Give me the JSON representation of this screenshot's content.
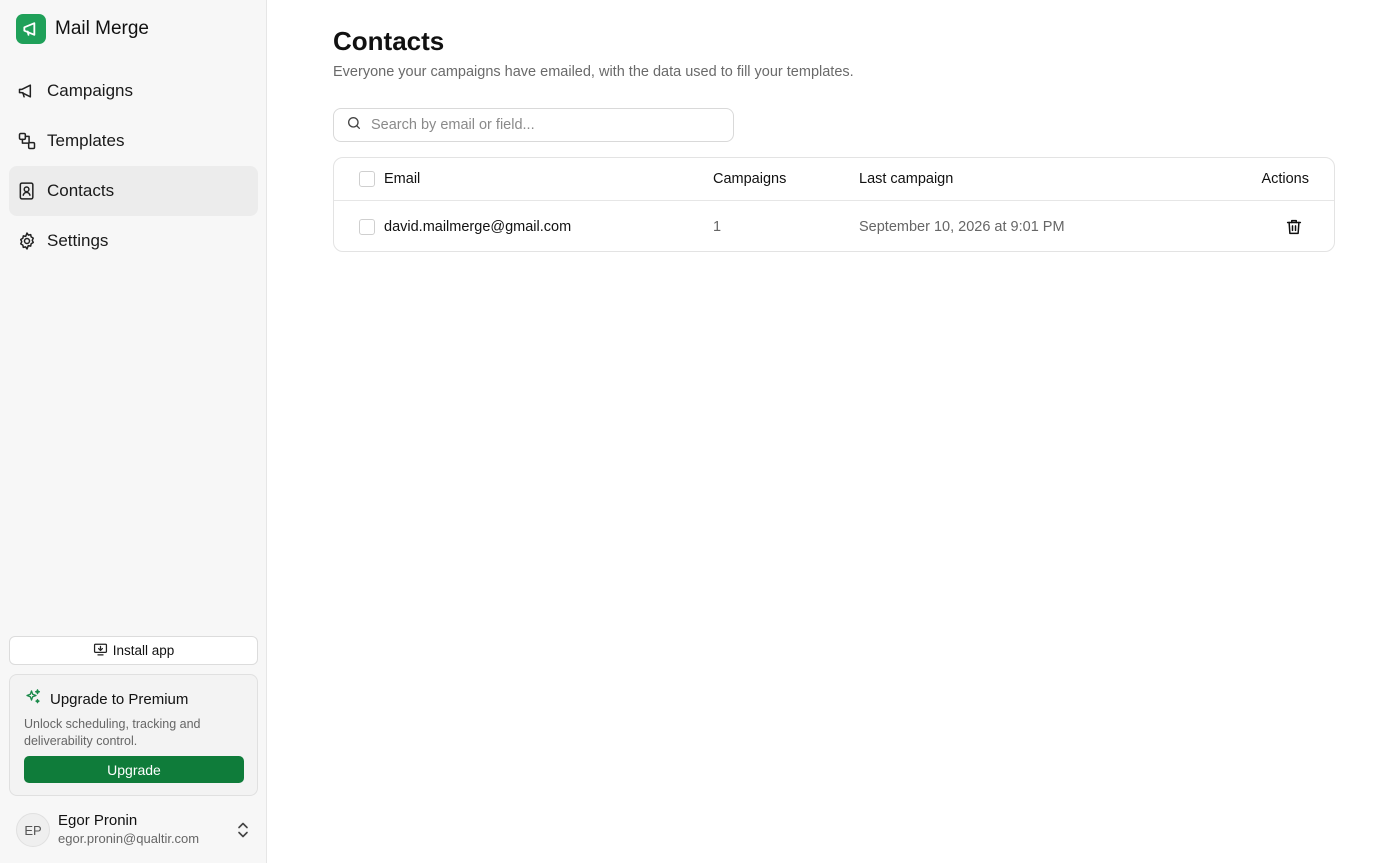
{
  "brand": {
    "name": "Mail Merge",
    "logo_icon": "megaphone-icon",
    "accent": "#1fa059"
  },
  "nav": [
    {
      "label": "Campaigns",
      "icon": "megaphone-icon",
      "active": false
    },
    {
      "label": "Templates",
      "icon": "templates-icon",
      "active": false
    },
    {
      "label": "Contacts",
      "icon": "contact-book-icon",
      "active": true
    },
    {
      "label": "Settings",
      "icon": "gear-icon",
      "active": false
    }
  ],
  "install": {
    "label": "Install app",
    "icon": "monitor-download-icon"
  },
  "premium": {
    "title": "Upgrade to Premium",
    "icon": "sparkles-icon",
    "description": "Unlock scheduling, tracking and deliverability control.",
    "button_label": "Upgrade",
    "button_color": "#0f7c3a"
  },
  "user": {
    "initials": "EP",
    "name": "Egor Pronin",
    "email": "egor.pronin@qualtir.com"
  },
  "page": {
    "title": "Contacts",
    "subtitle": "Everyone your campaigns have emailed, with the data used to fill your templates."
  },
  "search": {
    "placeholder": "Search by email or field...",
    "value": ""
  },
  "table": {
    "columns": {
      "email": "Email",
      "campaigns": "Campaigns",
      "last_campaign": "Last campaign",
      "actions": "Actions"
    },
    "rows": [
      {
        "email": "david.mailmerge@gmail.com",
        "campaigns": "1",
        "last_campaign": "September 10, 2026 at 9:01 PM"
      }
    ]
  }
}
